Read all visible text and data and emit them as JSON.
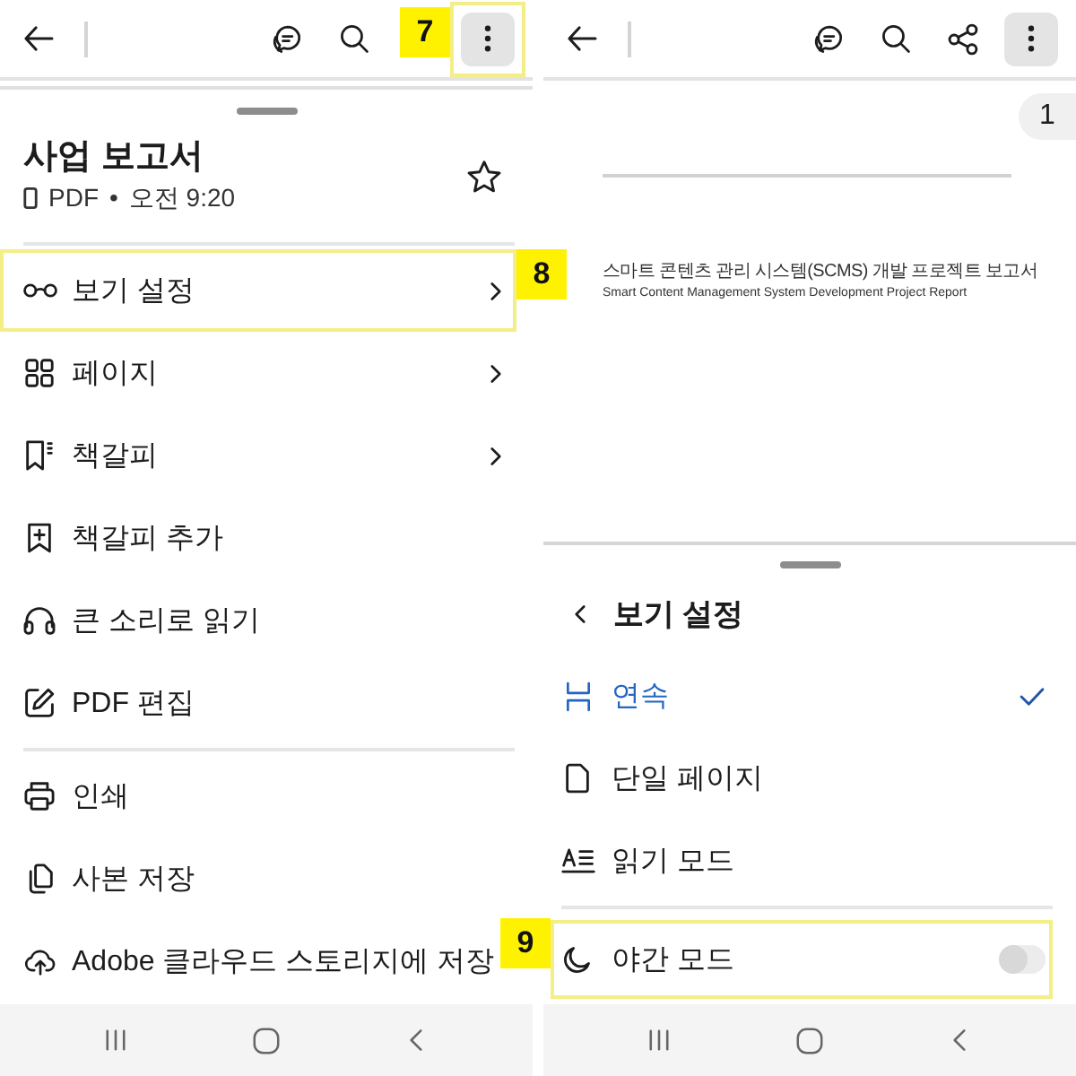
{
  "left_screen": {
    "toolbar": {
      "actions": [
        {
          "kind": "comment",
          "pressed": false,
          "highlighted": false
        },
        {
          "kind": "search",
          "pressed": false,
          "highlighted": false
        },
        {
          "kind": "more",
          "pressed": true,
          "highlighted": true,
          "callout": "7"
        }
      ]
    },
    "sheet": {
      "title": "사업 보고서",
      "file_type": "PDF",
      "separator": "•",
      "time": "오전 9:20",
      "starred": false,
      "groups": [
        {
          "items": [
            {
              "label": "보기 설정",
              "submenu": true,
              "highlighted": true,
              "callout": "8"
            },
            {
              "label": "페이지",
              "submenu": true,
              "highlighted": false
            },
            {
              "label": "책갈피",
              "submenu": true,
              "highlighted": false
            },
            {
              "label": "책갈피 추가",
              "submenu": false,
              "highlighted": false
            },
            {
              "label": "큰 소리로 읽기",
              "submenu": false,
              "highlighted": false
            },
            {
              "label": "PDF 편집",
              "submenu": false,
              "highlighted": false
            }
          ]
        },
        {
          "items": [
            {
              "label": "인쇄",
              "submenu": false,
              "highlighted": false
            },
            {
              "label": "사본 저장",
              "submenu": false,
              "highlighted": false
            },
            {
              "label": "Adobe 클라우드 스토리지에 저장",
              "submenu": false,
              "highlighted": false
            }
          ]
        }
      ]
    }
  },
  "right_screen": {
    "toolbar": {
      "actions": [
        {
          "kind": "comment",
          "pressed": false,
          "highlighted": false
        },
        {
          "kind": "search",
          "pressed": false,
          "highlighted": false
        },
        {
          "kind": "share",
          "pressed": false,
          "highlighted": false
        },
        {
          "kind": "more",
          "pressed": true,
          "highlighted": false
        }
      ]
    },
    "document": {
      "page_number": "1",
      "heading_lines": [
        "스마트 콘텐츠 관리 시스템(SCMS) 개발 프로젝트 보고서",
        "Smart Content Management System Development Project Report"
      ]
    },
    "sheet": {
      "title": "보기 설정",
      "options": [
        {
          "label": "연속",
          "selected": true
        },
        {
          "label": "단일 페이지",
          "selected": false
        },
        {
          "label": "읽기 모드",
          "selected": false
        }
      ],
      "night_mode": {
        "label": "야간 모드",
        "on": false,
        "highlighted": true,
        "callout": "9"
      }
    }
  }
}
